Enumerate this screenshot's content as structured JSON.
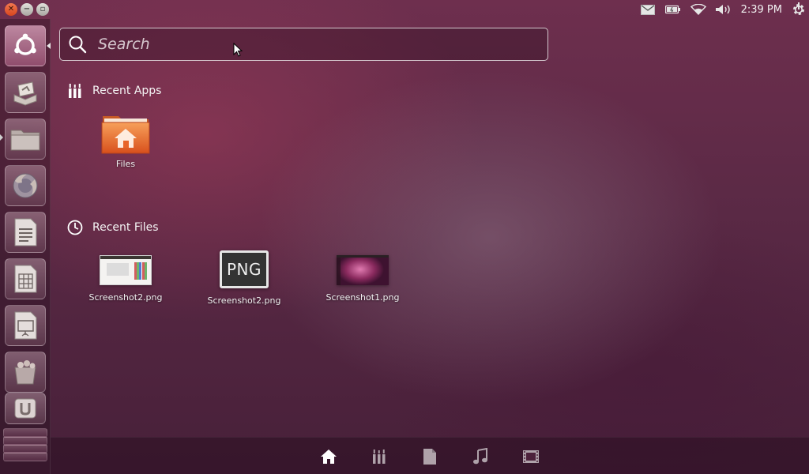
{
  "top_panel": {
    "clock": "2:39 PM",
    "window_controls": [
      "close-icon",
      "minimize-icon",
      "maximize-icon"
    ],
    "indicators": [
      "mail-icon",
      "battery-icon",
      "wifi-icon",
      "volume-icon",
      "gear-icon"
    ]
  },
  "launcher": {
    "items": [
      "ubuntu-logo-icon",
      "installer-icon",
      "folder-icon",
      "firefox-icon",
      "writer-icon",
      "calc-icon",
      "impress-icon",
      "software-center-icon",
      "ubuntu-one-icon"
    ]
  },
  "search": {
    "placeholder": "Search",
    "value": ""
  },
  "recent_apps": {
    "title": "Recent Apps",
    "items": [
      {
        "label": "Files",
        "icon": "home-folder-icon"
      }
    ]
  },
  "recent_files": {
    "title": "Recent Files",
    "items": [
      {
        "label": "Screenshot2.png"
      },
      {
        "label": "Screenshot2.png",
        "thumb_text": "PNG"
      },
      {
        "label": "Screenshot1.png"
      }
    ]
  },
  "lens_bar": {
    "lenses": [
      "home-lens-icon",
      "apps-lens-icon",
      "files-lens-icon",
      "music-lens-icon",
      "video-lens-icon"
    ],
    "active": "home-lens-icon"
  },
  "colors": {
    "close_button": "#e5552a",
    "folder_orange": "#f0703a",
    "text": "#ffffff"
  }
}
